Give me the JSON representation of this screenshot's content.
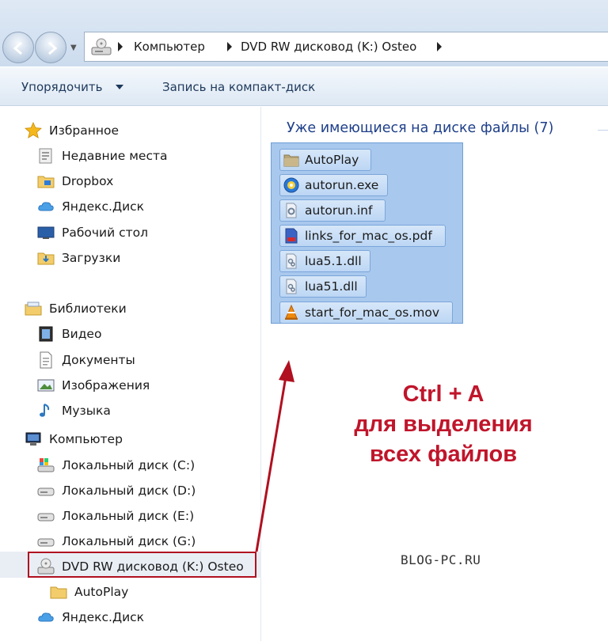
{
  "address_bar": {
    "breadcrumbs": [
      "Компьютер",
      "DVD RW дисковод (K:) Osteo"
    ]
  },
  "toolbar": {
    "organize_label": "Упорядочить",
    "burn_label": "Запись на компакт-диск"
  },
  "nav_pane": {
    "favorites": {
      "label": "Избранное",
      "items": [
        "Недавние места",
        "Dropbox",
        "Яндекс.Диск",
        "Рабочий стол",
        "Загрузки"
      ]
    },
    "libraries": {
      "label": "Библиотеки",
      "items": [
        "Видео",
        "Документы",
        "Изображения",
        "Музыка"
      ]
    },
    "computer": {
      "label": "Компьютер",
      "items": [
        "Локальный диск (C:)",
        "Локальный диск (D:)",
        "Локальный диск (E:)",
        "Локальный диск (G:)",
        "DVD RW дисковод (K:) Osteo"
      ],
      "sub_items": [
        "AutoPlay"
      ]
    },
    "bottom_item": "Яндекс.Диск"
  },
  "content": {
    "group_header": "Уже имеющиеся на диске файлы (7)",
    "files": [
      "AutoPlay",
      "autorun.exe",
      "autorun.inf",
      "links_for_mac_os.pdf",
      "lua5.1.dll",
      "lua51.dll",
      "start_for_mac_os.mov"
    ]
  },
  "annotation": {
    "line1": "Ctrl + A",
    "line2": "для выделения",
    "line3": "всех файлов"
  },
  "watermark": "BLOG-PC.RU",
  "colors": {
    "annotation_red": "#c0152b",
    "selection_blue": "#a8c8ed",
    "header_blue": "#1e3f8a"
  }
}
